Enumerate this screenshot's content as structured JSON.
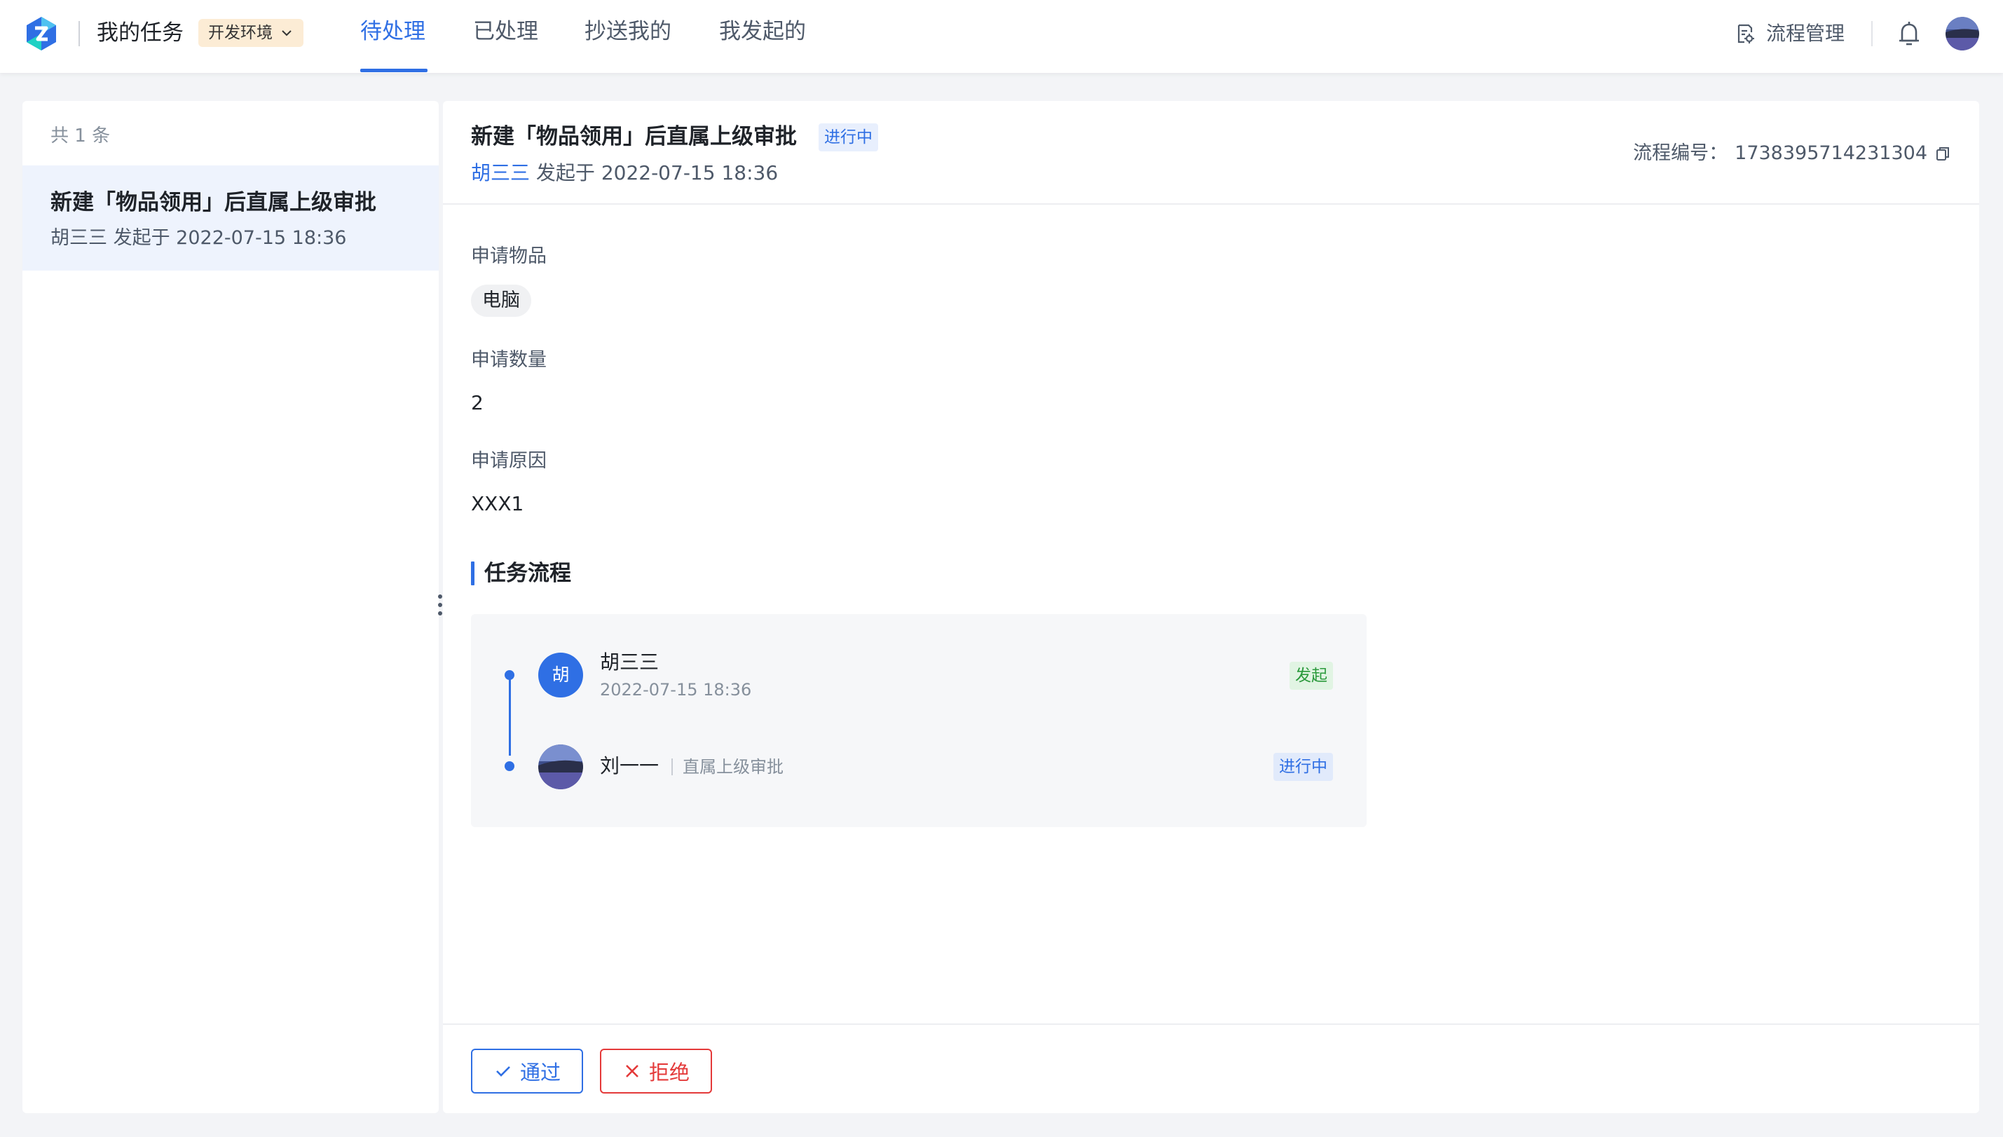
{
  "header": {
    "app_title": "我的任务",
    "env_label": "开发环境",
    "tabs": [
      {
        "label": "待处理",
        "active": true
      },
      {
        "label": "已处理",
        "active": false
      },
      {
        "label": "抄送我的",
        "active": false
      },
      {
        "label": "我发起的",
        "active": false
      }
    ],
    "process_mgmt": "流程管理"
  },
  "list": {
    "count": "共 1 条",
    "items": [
      {
        "title": "新建「物品领用」后直属上级审批",
        "subtitle": "胡三三 发起于 2022-07-15 18:36",
        "selected": true
      }
    ]
  },
  "detail": {
    "title": "新建「物品领用」后直属上级审批",
    "status": "进行中",
    "initiator": "胡三三",
    "initiated_text": "发起于 2022-07-15 18:36",
    "process_no_label": "流程编号：",
    "process_no": "1738395714231304",
    "fields": [
      {
        "label": "申请物品",
        "value": "电脑"
      },
      {
        "label": "申请数量",
        "value": "2"
      },
      {
        "label": "申请原因",
        "value": "XXX1"
      }
    ],
    "flow_section_title": "任务流程",
    "flow": [
      {
        "avatar_text": "胡",
        "name": "胡三三",
        "time": "2022-07-15 18:36",
        "tag": "发起"
      },
      {
        "name": "刘一一",
        "node": "直属上级审批",
        "tag": "进行中"
      }
    ]
  },
  "actions": {
    "approve": "通过",
    "reject": "拒绝"
  },
  "colors": {
    "primary": "#2f6fe4",
    "danger": "#e43a3a",
    "success": "#2b9a3c",
    "env_badge_bg": "#fcecd5"
  },
  "icons": {
    "logo": "app-logo",
    "env_dropdown": "chevron-down-icon",
    "process_mgmt": "document-settings-icon",
    "bell": "bell-icon",
    "copy": "copy-icon",
    "approve": "check-icon",
    "reject": "close-icon"
  }
}
